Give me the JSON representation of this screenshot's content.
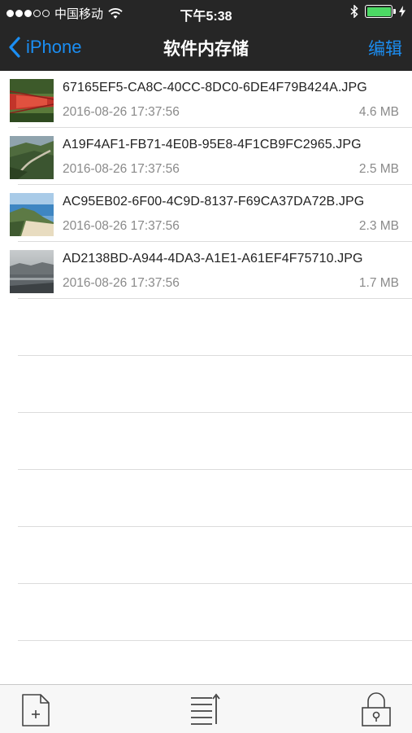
{
  "status_bar": {
    "carrier": "中国移动",
    "time": "下午5:38",
    "signal_bars_filled": 3,
    "signal_bars_total": 5,
    "battery_level": 1.0,
    "battery_color": "#4cd964"
  },
  "nav": {
    "back_label": "iPhone",
    "title": "软件内存储",
    "edit_label": "编辑",
    "accent_color": "#1b8ef3"
  },
  "files": [
    {
      "name": "67165EF5-CA8C-40CC-8DC0-6DE4F79B424A.JPG",
      "date": "2016-08-26 17:37:56",
      "size": "4.6 MB"
    },
    {
      "name": "A19F4AF1-FB71-4E0B-95E8-4F1CB9FC2965.JPG",
      "date": "2016-08-26 17:37:56",
      "size": "2.5 MB"
    },
    {
      "name": "AC95EB02-6F00-4C9D-8137-F69CA37DA72B.JPG",
      "date": "2016-08-26 17:37:56",
      "size": "2.3 MB"
    },
    {
      "name": "AD2138BD-A944-4DA3-A1E1-A61EF4F75710.JPG",
      "date": "2016-08-26 17:37:56",
      "size": "1.7 MB"
    }
  ],
  "toolbar": {
    "add_icon": "add-file-icon",
    "list_icon": "sort-list-icon",
    "lock_icon": "lock-icon"
  }
}
